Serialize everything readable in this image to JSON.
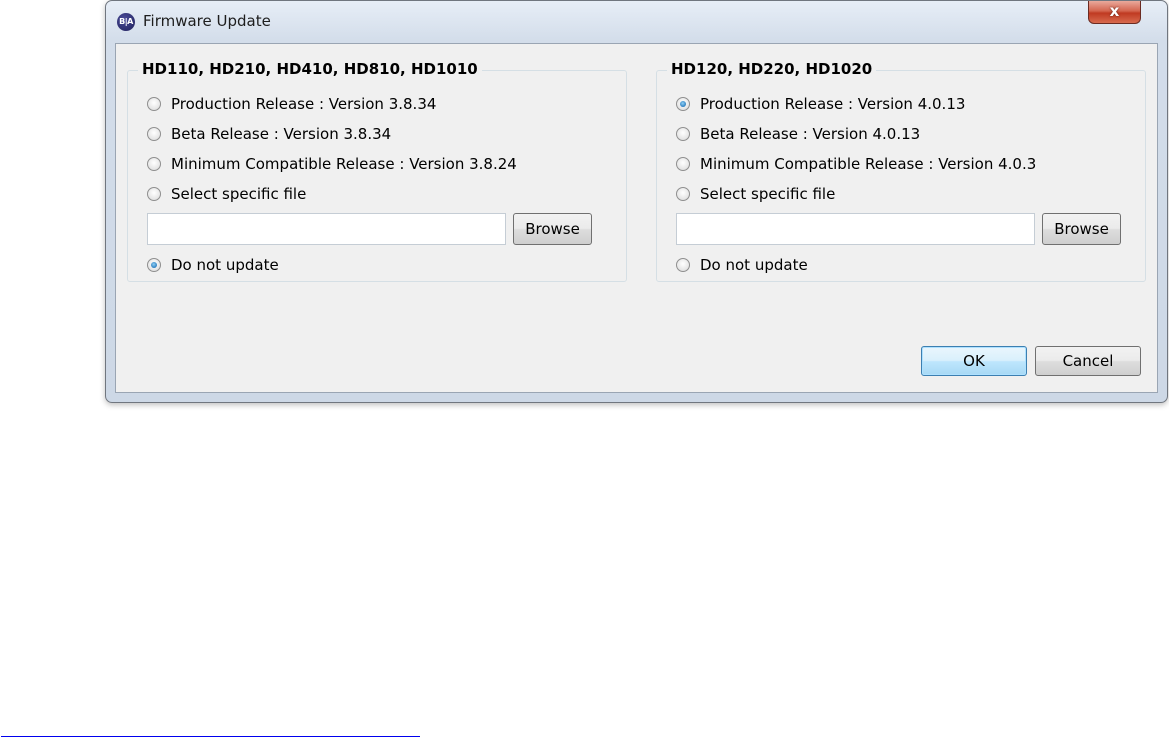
{
  "window": {
    "title": "Firmware Update",
    "icon_text": "B|A",
    "close_label": "x"
  },
  "groups": {
    "left": {
      "title": "HD110, HD210, HD410, HD810, HD1010",
      "options": [
        {
          "label": "Production Release : Version 3.8.34",
          "checked": false
        },
        {
          "label": "Beta Release : Version 3.8.34",
          "checked": false
        },
        {
          "label": "Minimum Compatible Release : Version 3.8.24",
          "checked": false
        },
        {
          "label": "Select specific file",
          "checked": false
        },
        {
          "label": "Do not update",
          "checked": true
        }
      ],
      "file_value": "",
      "browse_label": "Browse"
    },
    "right": {
      "title": "HD120, HD220, HD1020",
      "options": [
        {
          "label": "Production Release : Version 4.0.13",
          "checked": true
        },
        {
          "label": "Beta Release : Version 4.0.13",
          "checked": false
        },
        {
          "label": "Minimum Compatible Release : Version 4.0.3",
          "checked": false
        },
        {
          "label": "Select specific file",
          "checked": false
        },
        {
          "label": "Do not update",
          "checked": false
        }
      ],
      "file_value": "",
      "browse_label": "Browse"
    }
  },
  "buttons": {
    "ok_label": "OK",
    "cancel_label": "Cancel"
  }
}
